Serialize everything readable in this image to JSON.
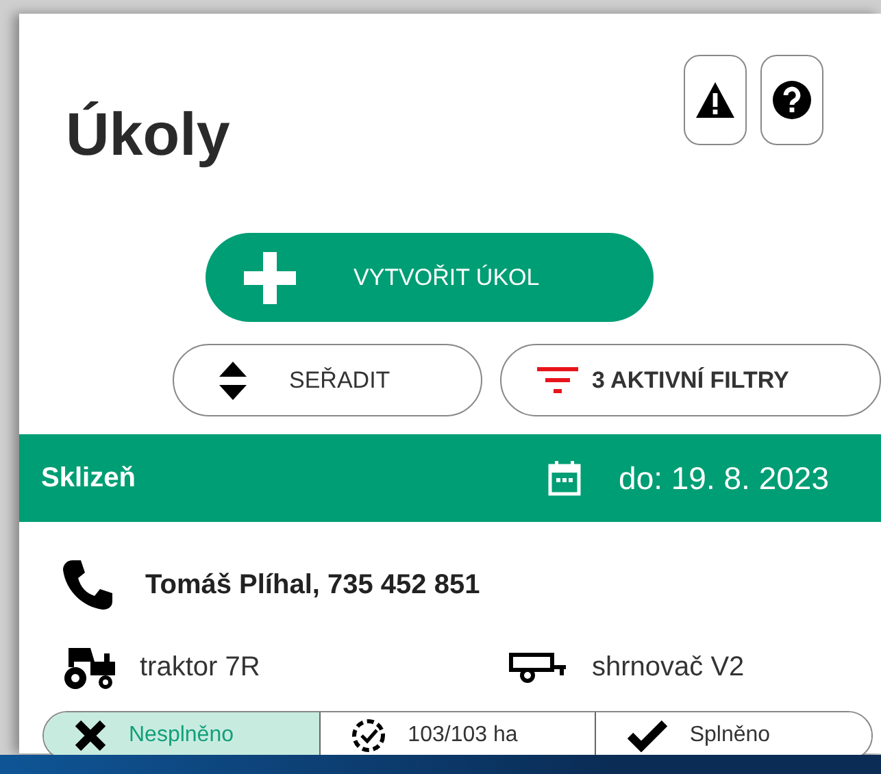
{
  "title": "Úkoly",
  "create_button": {
    "label": "VYTVOŘIT ÚKOL"
  },
  "sort_button": {
    "label": "SEŘADIT"
  },
  "filter_button": {
    "label": "3 AKTIVNÍ FILTRY"
  },
  "task": {
    "name": "Sklizeň",
    "due": "do: 19. 8. 2023",
    "contact": "Tomáš Plíhal, 735 452 851",
    "machine": "traktor 7R",
    "implement": "shrnovač V2",
    "status_options": [
      {
        "kind": "failed",
        "label": "Nesplněno",
        "selected": true
      },
      {
        "kind": "progress",
        "label": "103/103 ha",
        "selected": false
      },
      {
        "kind": "done",
        "label": "Splněno",
        "selected": false
      }
    ]
  }
}
